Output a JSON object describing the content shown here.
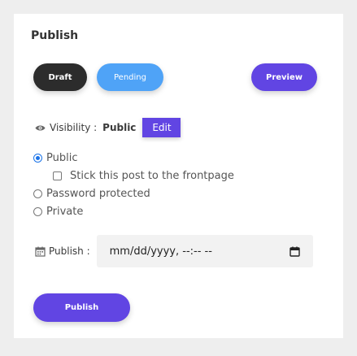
{
  "panel": {
    "title": "Publish"
  },
  "status_buttons": {
    "draft": "Draft",
    "pending": "Pending",
    "preview": "Preview"
  },
  "visibility": {
    "label": "Visibility :",
    "value": "Public",
    "edit_label": "Edit"
  },
  "options": {
    "public": "Public",
    "sticky": "Stick this post to the frontpage",
    "password": "Password protected",
    "private": "Private",
    "selected": "public"
  },
  "publish_date": {
    "label": "Publish :",
    "value": "mm/dd/yyyy, --:-- --"
  },
  "publish_button": "Publish",
  "colors": {
    "accent": "#6145e3",
    "pending": "#4fa3f7",
    "draft": "#2c2c2c"
  },
  "icons": {
    "visibility": "eye-icon",
    "date": "calendar-icon"
  }
}
